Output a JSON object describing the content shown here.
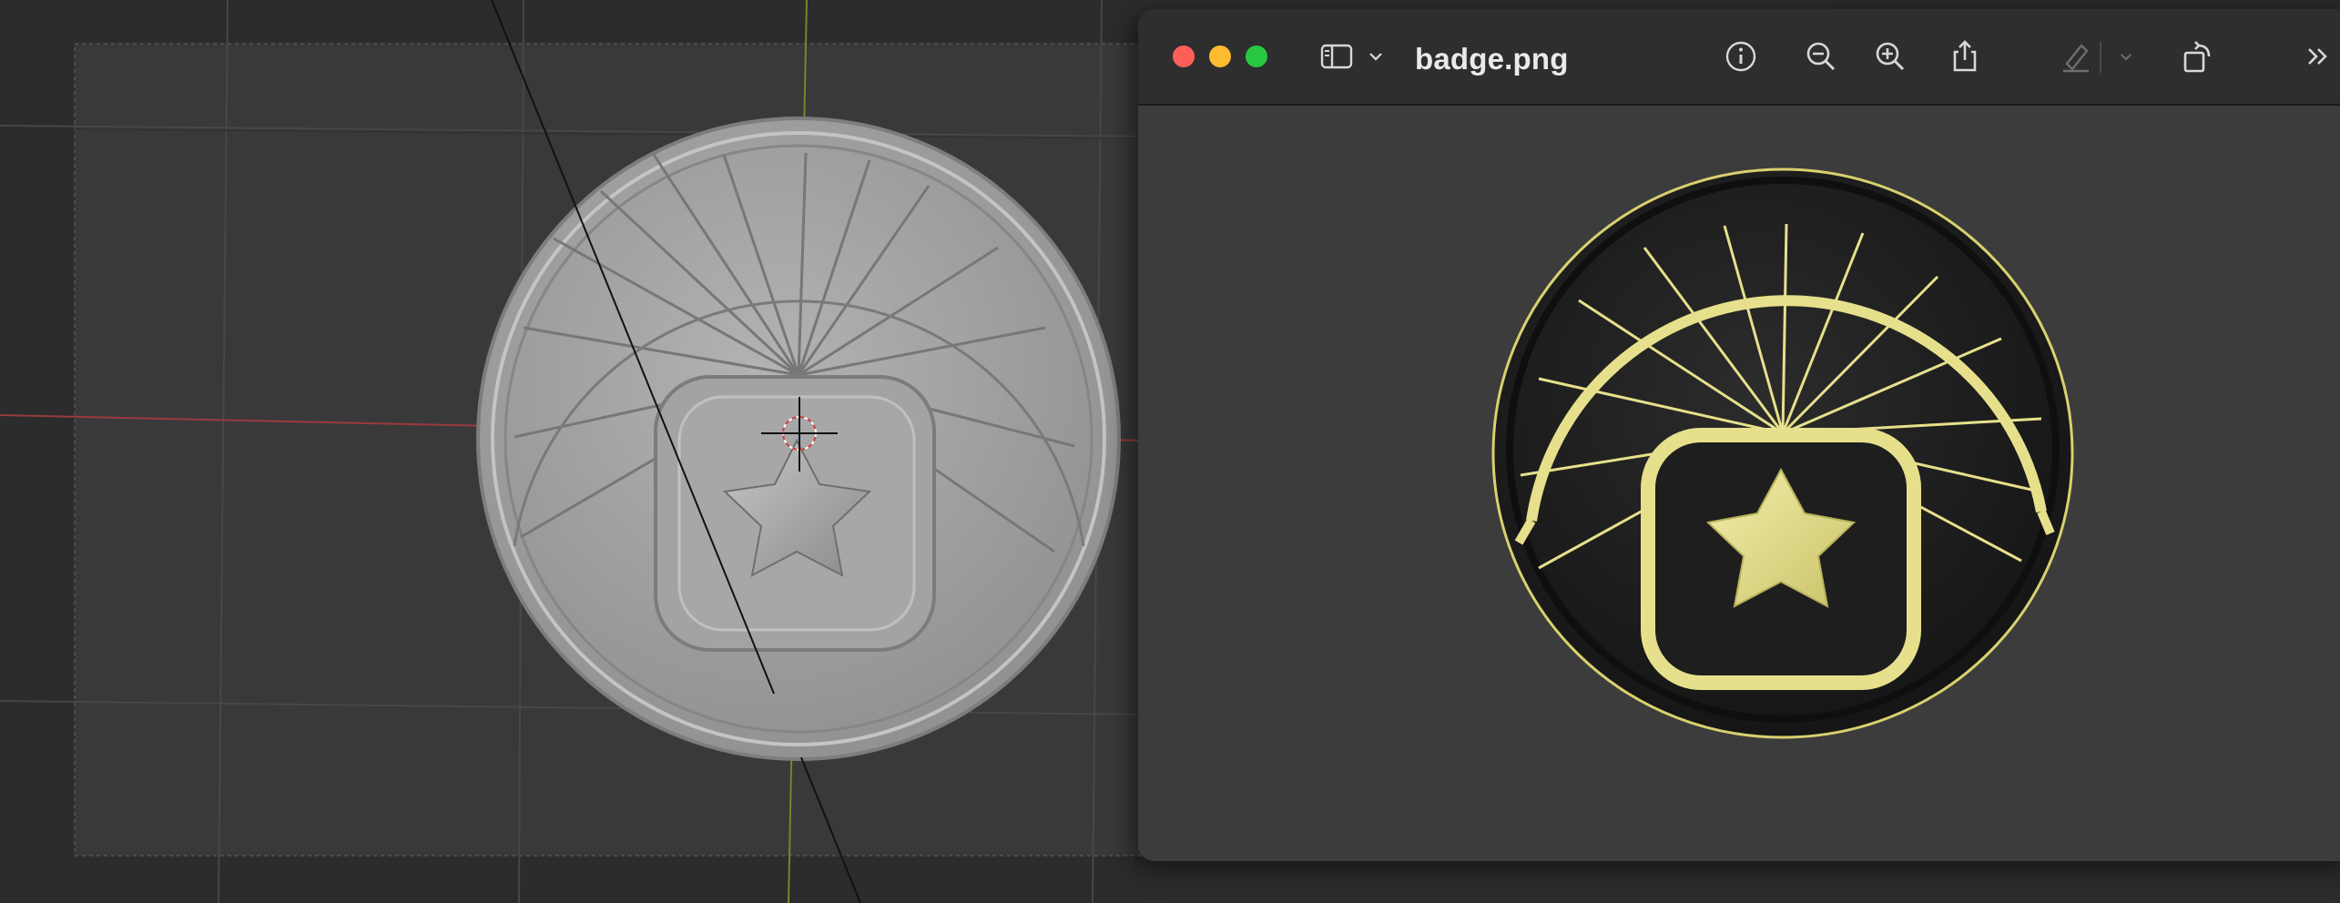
{
  "preview": {
    "title": "badge.png",
    "toolbar": [
      {
        "name": "sidebar-toggle-icon"
      },
      {
        "name": "chevron-down-icon"
      },
      {
        "name": "info-icon"
      },
      {
        "name": "zoom-out-icon"
      },
      {
        "name": "zoom-in-icon"
      },
      {
        "name": "share-icon"
      },
      {
        "name": "markup-pen-icon"
      },
      {
        "name": "markup-chevron-icon"
      },
      {
        "name": "rotate-icon"
      },
      {
        "name": "more-chevrons-icon"
      }
    ]
  },
  "colors": {
    "viewport_bg": "#2c2c2c",
    "camera_frame": "#393939",
    "grid_line": "#3a3a3a",
    "x_axis": "#9a3a3e",
    "y_axis": "#6d8a2a",
    "clay": "#a8a8a8",
    "badge_black": "#1f1f1f",
    "badge_gold": "#e6e08c",
    "window_bg": "#3c3c3c",
    "titlebar_bg": "#2e2e2e"
  }
}
